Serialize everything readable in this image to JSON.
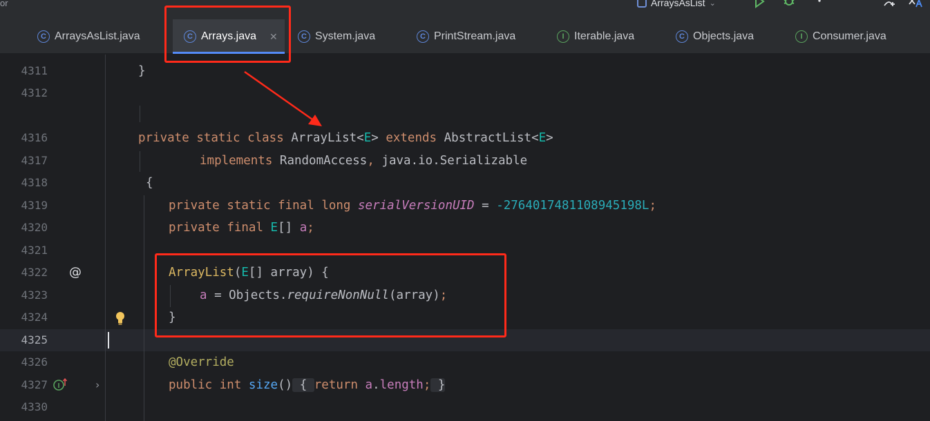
{
  "toolbar": {
    "left_text": "or",
    "run_config": "ArraysAsList"
  },
  "tabs": [
    {
      "label": "ArraysAsList.java",
      "kind": "class",
      "icon_letter": "C",
      "active": false
    },
    {
      "label": "Arrays.java",
      "kind": "class",
      "icon_letter": "C",
      "active": true
    },
    {
      "label": "System.java",
      "kind": "class",
      "icon_letter": "C",
      "active": false
    },
    {
      "label": "PrintStream.java",
      "kind": "class",
      "icon_letter": "C",
      "active": false
    },
    {
      "label": "Iterable.java",
      "kind": "interface",
      "icon_letter": "I",
      "active": false
    },
    {
      "label": "Objects.java",
      "kind": "class",
      "icon_letter": "C",
      "active": false
    },
    {
      "label": "Consumer.java",
      "kind": "interface",
      "icon_letter": "I",
      "active": false
    }
  ],
  "editor": {
    "current_line": "4325",
    "lines": {
      "l4311": {
        "num": "4311",
        "code": "}"
      },
      "l4312": {
        "num": "4312",
        "code": ""
      },
      "l4316": {
        "num": "4316"
      },
      "l4317": {
        "num": "4317"
      },
      "l4318": {
        "num": "4318",
        "code": "{"
      },
      "l4319": {
        "num": "4319"
      },
      "l4320": {
        "num": "4320"
      },
      "l4321": {
        "num": "4321",
        "code": ""
      },
      "l4322": {
        "num": "4322"
      },
      "l4323": {
        "num": "4323"
      },
      "l4324": {
        "num": "4324",
        "code": "}"
      },
      "l4325": {
        "num": "4325",
        "code": ""
      },
      "l4326": {
        "num": "4326",
        "code": "@Override"
      },
      "l4327": {
        "num": "4327"
      },
      "l4330": {
        "num": "4330",
        "code": ""
      }
    },
    "tokens": {
      "private": "private",
      "static": "static",
      "class": "class",
      "final": "final",
      "long": "long",
      "implements": "implements",
      "extends": "extends",
      "public": "public",
      "int": "int",
      "return": "return",
      "ArrayList": "ArrayList",
      "AbstractList": "AbstractList",
      "E": "E",
      "RandomAccess": "RandomAccess",
      "Serializable": "java.io.Serializable",
      "serialVersionUID": "serialVersionUID",
      "serialValue": "-2764017481108945198L",
      "a": "a",
      "array": "array",
      "Objects": "Objects",
      "requireNonNull": "requireNonNull",
      "size": "size",
      "length": "length"
    },
    "gutter": {
      "at_icon": "@",
      "bulb_icon": "lightbulb-icon",
      "impl_icon": "I",
      "expand_icon": "›"
    }
  },
  "colors": {
    "annotation_red": "#ff2a1a",
    "keyword": "#cf8e6d",
    "generic": "#16baac",
    "field": "#c77dbb",
    "number": "#2aacb8",
    "function": "#56a8f5",
    "annotation": "#b3ae60"
  }
}
